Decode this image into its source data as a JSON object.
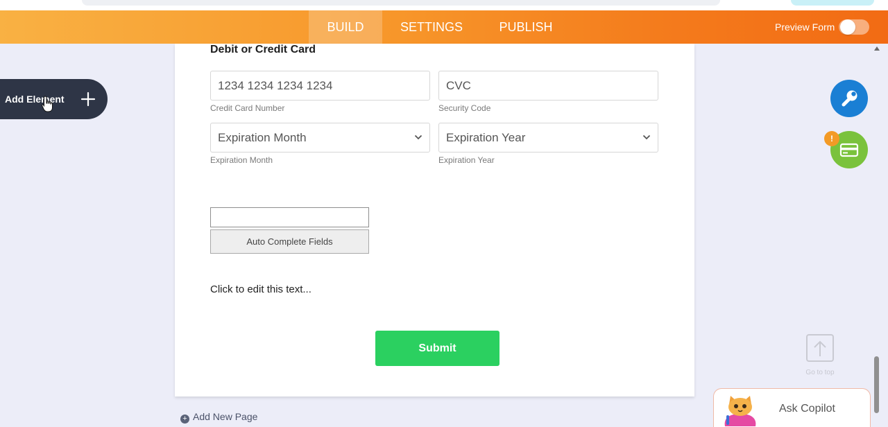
{
  "navbar": {
    "tabs": [
      {
        "label": "BUILD",
        "active": true
      },
      {
        "label": "SETTINGS",
        "active": false
      },
      {
        "label": "PUBLISH",
        "active": false
      }
    ],
    "preview_label": "Preview Form"
  },
  "sidebar": {
    "add_element_label": "Add Element"
  },
  "form": {
    "section_title": "Debit or Credit Card",
    "card_number": {
      "placeholder": "1234 1234 1234 1234",
      "sublabel": "Credit Card Number"
    },
    "cvc": {
      "placeholder": "CVC",
      "sublabel": "Security Code"
    },
    "exp_month": {
      "value": "Expiration Month",
      "sublabel": "Expiration Month"
    },
    "exp_year": {
      "value": "Expiration Year",
      "sublabel": "Expiration Year"
    },
    "autocomplete_button": "Auto Complete Fields",
    "edit_text": "Click to edit this text...",
    "submit_label": "Submit"
  },
  "footer": {
    "add_page_label": "Add New Page"
  },
  "right": {
    "badge": "!",
    "go_top_label": "Go to top",
    "copilot_label": "Ask Copilot"
  },
  "colors": {
    "accent_orange": "#f47b1c",
    "submit_green": "#2bd060",
    "fab_blue": "#1a7fd4",
    "fab_green": "#7ac23c"
  }
}
